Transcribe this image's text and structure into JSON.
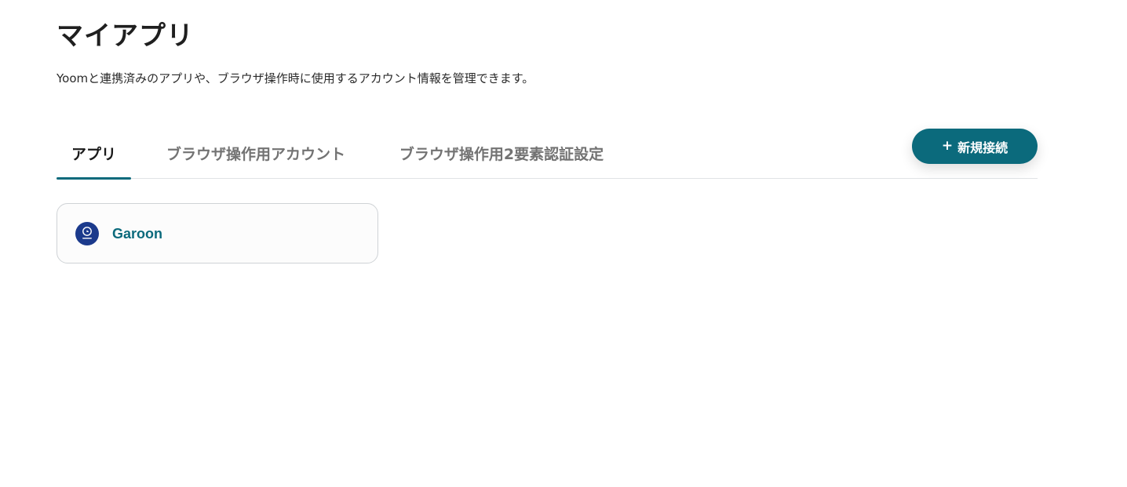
{
  "page": {
    "title": "マイアプリ",
    "description": "Yoomと連携済みのアプリや、ブラウザ操作時に使用するアカウント情報を管理できます。"
  },
  "tabs": [
    {
      "label": "アプリ",
      "active": true
    },
    {
      "label": "ブラウザ操作用アカウント",
      "active": false
    },
    {
      "label": "ブラウザ操作用2要素認証設定",
      "active": false
    }
  ],
  "actions": {
    "new_connection_plus": "+",
    "new_connection_label": "新規接続"
  },
  "apps": [
    {
      "name": "Garoon",
      "icon": "garoon-logo-icon"
    }
  ],
  "colors": {
    "accent": "#0b6a7c",
    "logo_bg": "#1b3a8c",
    "divider": "#e0e3e5"
  }
}
